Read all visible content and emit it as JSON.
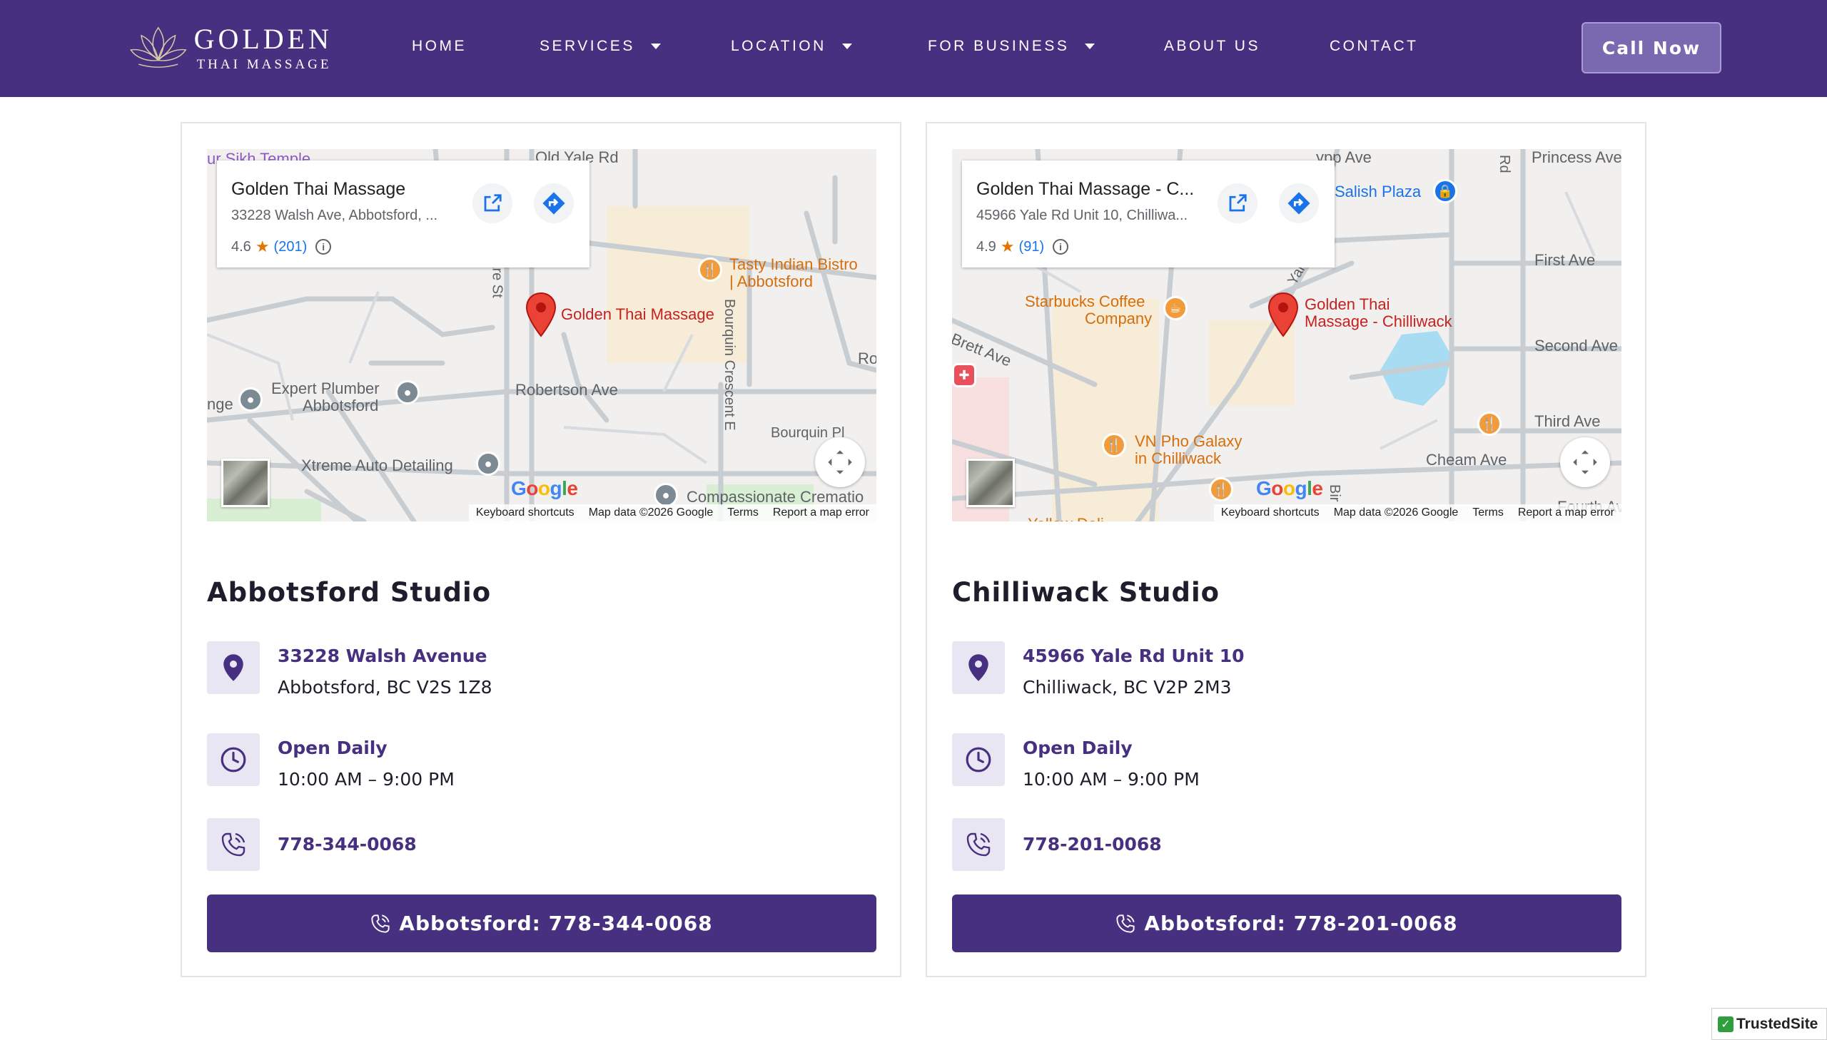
{
  "header": {
    "logo_title": "GOLDEN",
    "logo_subtitle": "THAI MASSAGE",
    "nav": [
      {
        "label": "HOME",
        "dropdown": false
      },
      {
        "label": "SERVICES",
        "dropdown": true
      },
      {
        "label": "LOCATION",
        "dropdown": true
      },
      {
        "label": "FOR BUSINESS",
        "dropdown": true
      },
      {
        "label": "ABOUT US",
        "dropdown": false
      },
      {
        "label": "CONTACT",
        "dropdown": false
      }
    ],
    "call_label": "Call Now"
  },
  "colors": {
    "brand_purple": "#46307f",
    "icon_bg": "#e9e6f4",
    "map_pin_red": "#ea4335"
  },
  "map_common": {
    "attribution": [
      "Keyboard shortcuts",
      "Map data ©2026 Google",
      "Terms",
      "Report a map error"
    ],
    "google_letters": [
      "G",
      "o",
      "o",
      "g",
      "l",
      "e"
    ]
  },
  "studios": [
    {
      "map": {
        "place_name": "Golden Thai Massage",
        "address_short": "33228 Walsh Ave, Abbotsford, ...",
        "rating": "4.6",
        "review_count": "(201)",
        "pin_label": "Golden Thai Massage",
        "labels": {
          "temple": "ur Sikh Temple",
          "restaurant_1": "Tasty Indian Bistro",
          "restaurant_2": "| Abbotsford",
          "poi_plumber_1": "Expert Plumber",
          "poi_plumber_2": "Abbotsford",
          "poi_auto": "Xtreme Auto Detailing",
          "poi_cremation": "Compassionate Crematio",
          "street_robertson": "Robertson Ave",
          "street_bourquin_pl": "Bourquin Pl",
          "street_bourquin_cres": "Bourquin Crescent E",
          "street_old_yale": "Old Yale Rd",
          "street_ro": "Ro",
          "street_nge": "nge",
          "street_are": "are St"
        }
      },
      "title": "Abbotsford Studio",
      "address_line1": "33228 Walsh Avenue",
      "address_line2": "Abbotsford, BC V2S 1Z8",
      "hours_label": "Open Daily",
      "hours": "10:00 AM – 9:00 PM",
      "phone": "778-344-0068",
      "button_label": "Abbotsford: 778-344-0068"
    },
    {
      "map": {
        "place_name": "Golden Thai Massage - C...",
        "address_short": "45966 Yale Rd Unit 10, Chilliwa...",
        "rating": "4.9",
        "review_count": "(91)",
        "pin_label_1": "Golden Thai",
        "pin_label_2": "Massage - Chilliwack",
        "labels": {
          "salish": "Salish Plaza",
          "starbucks_1": "Starbucks Coffee",
          "starbucks_2": "Company",
          "pho_1": "VN Pho Galaxy",
          "pho_2": "in Chilliwack",
          "yellow_deli": "Yellow Deli",
          "street_princess": "Princess Ave",
          "street_first": "First Ave",
          "street_second": "Second Ave",
          "street_third": "Third Ave",
          "street_fourth": "Fourth Ave",
          "street_cheam": "Cheam Ave",
          "street_brett": "Brett Ave",
          "street_ypp": "ypp Ave",
          "street_yale": "Yale",
          "street_rd": "Rd",
          "street_bir": "Bir"
        }
      },
      "title": "Chilliwack Studio",
      "address_line1": "45966 Yale Rd Unit 10",
      "address_line2": "Chilliwack, BC V2P 2M3",
      "hours_label": "Open Daily",
      "hours": "10:00 AM – 9:00 PM",
      "phone": "778-201-0068",
      "button_label": "Abbotsford: 778-201-0068"
    }
  ],
  "trusted_badge": "TrustedSite"
}
